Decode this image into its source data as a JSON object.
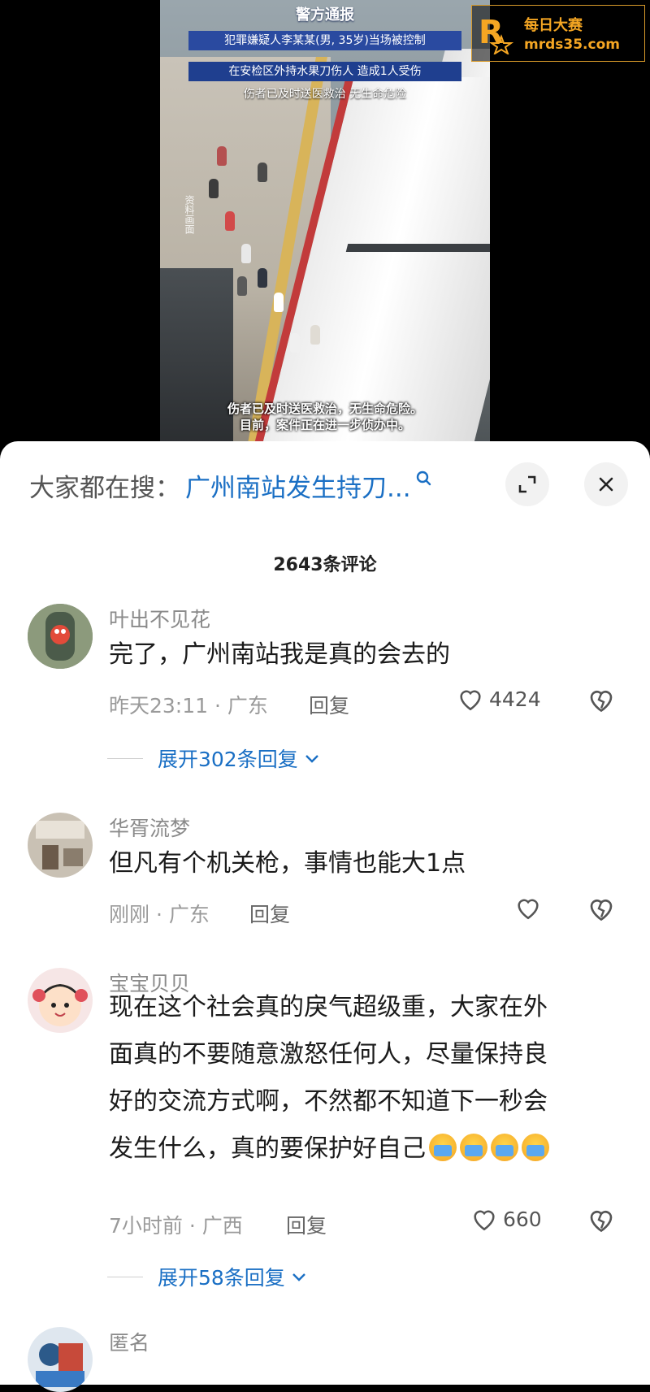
{
  "video": {
    "title": "警方通报",
    "line1": "犯罪嫌疑人李某某(男, 35岁)当场被控制",
    "line2": "在安检区外持水果刀伤人 造成1人受伤",
    "line3": "伤者已及时送医救治 无生命危险",
    "side_tag": "资料画面",
    "subtitle1": "伤者已及时送医救治，无生命危险。",
    "subtitle2": "目前，案件正在进一步侦办中。",
    "watermark_line1": "每日大赛",
    "watermark_line2": "mrds35.com"
  },
  "search": {
    "label": "大家都在搜：",
    "term": "广州南站发生持刀..."
  },
  "comment_count": "2643条评论",
  "comments": [
    {
      "username": "叶出不见花",
      "text": "完了，广州南站我是真的会去的",
      "time": "昨天23:11 · 广东",
      "reply": "回复",
      "likes": "4424",
      "expand": "展开302条回复"
    },
    {
      "username": "华胥流梦",
      "text": "但凡有个机关枪，事情也能大1点",
      "time": "刚刚 · 广东",
      "reply": "回复",
      "likes": ""
    },
    {
      "username": "宝宝贝贝",
      "text_lines": [
        "现在这个社会真的戾气超级重，大家在外",
        "面真的不要随意激怒任何人，尽量保持良",
        "好的交流方式啊，不然都不知道下一秒会",
        "发生什么，真的要保护好自己"
      ],
      "time": "7小时前 · 广西",
      "reply": "回复",
      "likes": "660",
      "expand": "展开58条回复"
    },
    {
      "username": "匿名"
    }
  ],
  "colors": {
    "accent": "#1a6fc4",
    "watermark": "#f5a623"
  }
}
